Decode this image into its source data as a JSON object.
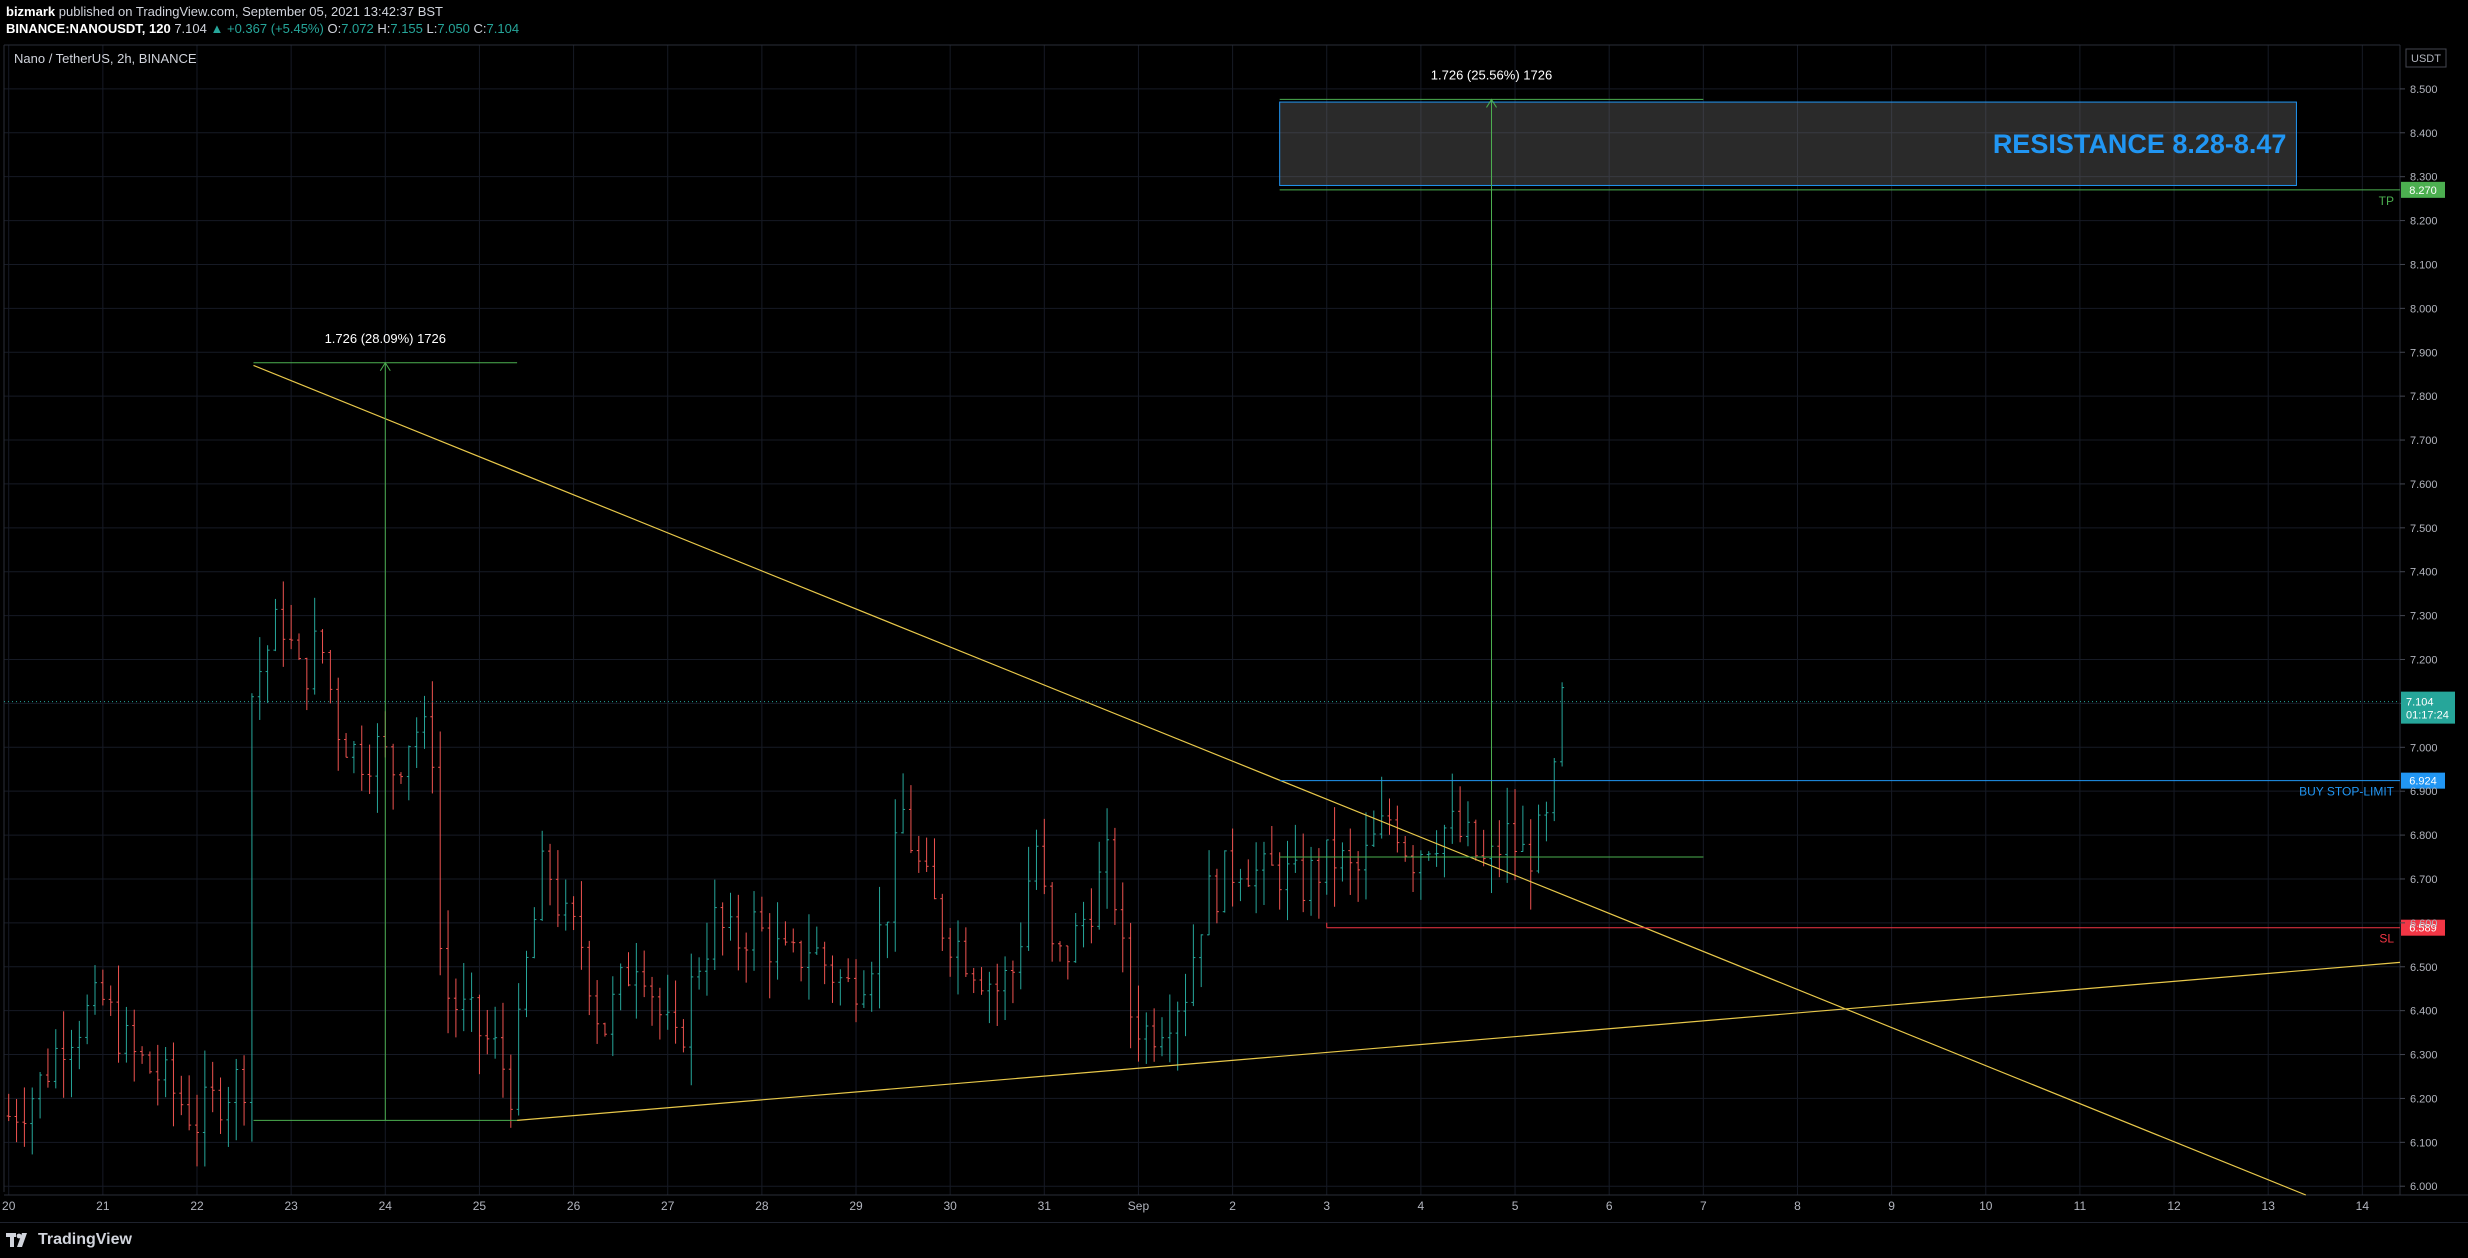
{
  "header": {
    "author": "bizmark",
    "published_text": "published on TradingView.com, September 05, 2021 13:42:37 BST",
    "symbol": "BINANCE:NANOUSDT, 120",
    "last": "7.104",
    "change": "▲ +0.367 (+5.45%)",
    "o_label": "O:",
    "o": "7.072",
    "h_label": "H:",
    "h": "7.155",
    "l_label": "L:",
    "l": "7.050",
    "c_label": "C:",
    "c": "7.104"
  },
  "footer": {
    "brand": "TradingView"
  },
  "chart_data": {
    "type": "candlestick",
    "title": "Nano / TetherUS, 2h, BINANCE",
    "currency": "USDT",
    "ylim": [
      5.98,
      8.6
    ],
    "xlim": [
      -0.05,
      25.4
    ],
    "y_ticks": [
      "6.000",
      "6.100",
      "6.200",
      "6.300",
      "6.400",
      "6.500",
      "6.600",
      "6.700",
      "6.800",
      "6.900",
      "7.000",
      "7.100",
      "7.200",
      "7.300",
      "7.400",
      "7.500",
      "7.600",
      "7.700",
      "7.800",
      "7.900",
      "8.000",
      "8.100",
      "8.200",
      "8.300",
      "8.400",
      "8.500"
    ],
    "x_ticks": [
      {
        "x": 0,
        "label": "20"
      },
      {
        "x": 1,
        "label": "21"
      },
      {
        "x": 2,
        "label": "22"
      },
      {
        "x": 3,
        "label": "23"
      },
      {
        "x": 4,
        "label": "24"
      },
      {
        "x": 5,
        "label": "25"
      },
      {
        "x": 6,
        "label": "26"
      },
      {
        "x": 7,
        "label": "27"
      },
      {
        "x": 8,
        "label": "28"
      },
      {
        "x": 9,
        "label": "29"
      },
      {
        "x": 10,
        "label": "30"
      },
      {
        "x": 11,
        "label": "31"
      },
      {
        "x": 12,
        "label": "Sep"
      },
      {
        "x": 13,
        "label": "2"
      },
      {
        "x": 14,
        "label": "3"
      },
      {
        "x": 15,
        "label": "4"
      },
      {
        "x": 16,
        "label": "5"
      },
      {
        "x": 17,
        "label": "6"
      },
      {
        "x": 18,
        "label": "7"
      },
      {
        "x": 19,
        "label": "8"
      },
      {
        "x": 20,
        "label": "9"
      },
      {
        "x": 21,
        "label": "10"
      },
      {
        "x": 22,
        "label": "11"
      },
      {
        "x": 23,
        "label": "12"
      },
      {
        "x": 24,
        "label": "13"
      },
      {
        "x": 25,
        "label": "14"
      }
    ],
    "price_path": [
      [
        0,
        6.16
      ],
      [
        0.3,
        6.22
      ],
      [
        0.6,
        6.35
      ],
      [
        1.0,
        6.42
      ],
      [
        1.3,
        6.3
      ],
      [
        1.6,
        6.25
      ],
      [
        2.0,
        6.15
      ],
      [
        2.3,
        6.22
      ],
      [
        2.5,
        6.25
      ],
      [
        2.55,
        7.1
      ],
      [
        2.7,
        7.2
      ],
      [
        2.9,
        7.3
      ],
      [
        3.1,
        7.15
      ],
      [
        3.3,
        7.25
      ],
      [
        3.5,
        7.05
      ],
      [
        3.7,
        6.98
      ],
      [
        3.9,
        7.0
      ],
      [
        4.1,
        6.95
      ],
      [
        4.3,
        7.05
      ],
      [
        4.5,
        7.0
      ],
      [
        4.6,
        6.45
      ],
      [
        4.8,
        6.4
      ],
      [
        5.0,
        6.35
      ],
      [
        5.2,
        6.3
      ],
      [
        5.35,
        6.22
      ],
      [
        5.5,
        6.5
      ],
      [
        5.7,
        6.75
      ],
      [
        5.9,
        6.6
      ],
      [
        6.1,
        6.55
      ],
      [
        6.3,
        6.35
      ],
      [
        6.5,
        6.45
      ],
      [
        6.7,
        6.55
      ],
      [
        6.9,
        6.4
      ],
      [
        7.1,
        6.3
      ],
      [
        7.3,
        6.5
      ],
      [
        7.5,
        6.6
      ],
      [
        7.7,
        6.55
      ],
      [
        7.9,
        6.6
      ],
      [
        8.1,
        6.55
      ],
      [
        8.3,
        6.5
      ],
      [
        8.5,
        6.55
      ],
      [
        8.7,
        6.5
      ],
      [
        8.9,
        6.45
      ],
      [
        9.1,
        6.5
      ],
      [
        9.3,
        6.6
      ],
      [
        9.5,
        6.85
      ],
      [
        9.7,
        6.7
      ],
      [
        9.9,
        6.6
      ],
      [
        10.1,
        6.55
      ],
      [
        10.3,
        6.5
      ],
      [
        10.5,
        6.45
      ],
      [
        10.7,
        6.5
      ],
      [
        10.9,
        6.8
      ],
      [
        11.1,
        6.5
      ],
      [
        11.3,
        6.55
      ],
      [
        11.5,
        6.65
      ],
      [
        11.7,
        6.75
      ],
      [
        11.9,
        6.4
      ],
      [
        12.1,
        6.35
      ],
      [
        12.3,
        6.4
      ],
      [
        12.5,
        6.45
      ],
      [
        12.7,
        6.65
      ],
      [
        12.9,
        6.7
      ],
      [
        13.1,
        6.75
      ],
      [
        13.3,
        6.7
      ],
      [
        13.5,
        6.72
      ],
      [
        13.7,
        6.68
      ],
      [
        13.9,
        6.72
      ],
      [
        14.1,
        6.75
      ],
      [
        14.3,
        6.7
      ],
      [
        14.5,
        6.78
      ],
      [
        14.7,
        6.85
      ],
      [
        14.9,
        6.75
      ],
      [
        15.1,
        6.8
      ],
      [
        15.3,
        6.82
      ],
      [
        15.5,
        6.78
      ],
      [
        15.7,
        6.72
      ],
      [
        15.9,
        6.8
      ],
      [
        16.1,
        6.75
      ],
      [
        16.3,
        6.8
      ],
      [
        16.4,
        6.85
      ],
      [
        16.45,
        7.05
      ],
      [
        16.5,
        7.1
      ]
    ],
    "trendlines": [
      {
        "from": [
          2.6,
          7.87
        ],
        "to": [
          24.4,
          5.98
        ],
        "color": "#e8c84a"
      },
      {
        "from": [
          5.4,
          6.15
        ],
        "to": [
          25.4,
          6.51
        ],
        "color": "#e8c84a"
      }
    ],
    "measures": [
      {
        "x": 4.0,
        "from": 6.15,
        "to": 7.876,
        "label": "1.726 (28.09%) 1726",
        "line_x1": 2.6,
        "line_x2": 5.4,
        "color": "#4caf50"
      },
      {
        "x": 15.75,
        "from": 6.75,
        "to": 8.476,
        "label": "1.726 (25.56%) 1726",
        "line_x1": 13.5,
        "line_x2": 18.0,
        "color": "#4caf50"
      }
    ],
    "resistance": {
      "x1": 13.5,
      "x2": 24.3,
      "y1": 8.28,
      "y2": 8.47,
      "label": "RESISTANCE 8.28-8.47",
      "color": "#2196f3"
    },
    "levels": [
      {
        "name": "tp",
        "y": 8.27,
        "x1": 13.5,
        "label": "TP",
        "price": "8.270",
        "color": "#4caf50"
      },
      {
        "name": "buy",
        "y": 6.924,
        "x1": 13.5,
        "label": "BUY STOP-LIMIT",
        "price": "6.924",
        "color": "#2196f3"
      },
      {
        "name": "sl",
        "y": 6.589,
        "x1": 14.0,
        "label": "SL",
        "price": "6.589",
        "color": "#f23645"
      }
    ],
    "entry_zone": {
      "y": 6.75,
      "x1": 13.5,
      "x2": 18.0,
      "color": "#4caf50"
    },
    "last_price": {
      "y": 7.104,
      "price": "7.104",
      "countdown": "01:17:24",
      "color": "#26a69a"
    }
  }
}
